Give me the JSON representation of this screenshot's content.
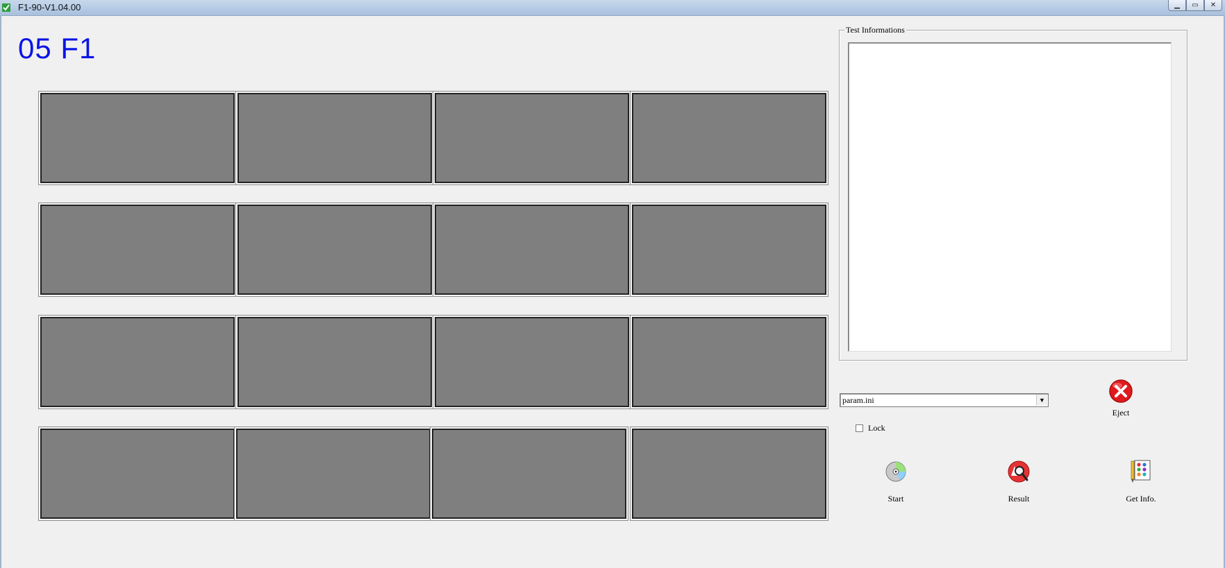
{
  "window": {
    "title": "F1-90-V1.04.00",
    "minimize_glyph": "▁",
    "maximize_glyph": "▭",
    "close_glyph": "✕"
  },
  "station": {
    "title": "05 F1"
  },
  "test_info": {
    "legend": "Test Informations",
    "content": ""
  },
  "config": {
    "selected": "param.ini",
    "arrow_glyph": "▼",
    "lock_label": "Lock",
    "lock_checked": false
  },
  "actions": {
    "eject": {
      "label": "Eject",
      "icon": "eject-x-icon"
    },
    "start": {
      "label": "Start",
      "icon": "disc-icon"
    },
    "result": {
      "label": "Result",
      "icon": "result-magnifier-icon"
    },
    "get_info": {
      "label": "Get Info.",
      "icon": "palette-icon"
    }
  },
  "slots": {
    "rows": 4,
    "columns": 4,
    "color": "#7f7f7f"
  },
  "colors": {
    "title_blue": "#0a14e6",
    "eject_red": "#e0191c"
  }
}
